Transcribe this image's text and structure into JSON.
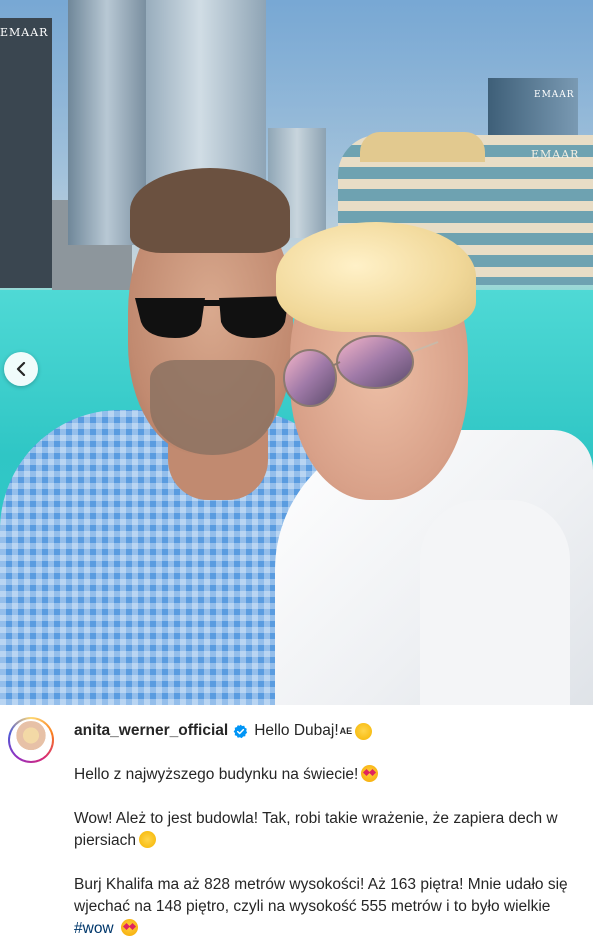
{
  "photo": {
    "signs": {
      "left": "EMAAR",
      "mall": "EMAAR",
      "tower": "EMAAR"
    },
    "carousel": {
      "prev_icon": "chevron-left-icon"
    }
  },
  "post": {
    "username": "anita_werner_official",
    "verified_icon": "verified-badge-icon",
    "headline": "Hello Dubaj!",
    "headline_flag": "AE",
    "paragraphs": [
      "Hello z najwyższego budynku na świecie!",
      "Wow! Ależ to jest budowla! Tak, robi takie wrażenie, że zapiera dech w piersiach",
      "Burj Khalifa ma aż 828 metrów wysokości! Aż 163 piętra! Mnie udało się wjechać na 148 piętro, czyli na wysokość 555 metrów i to było wielkie"
    ],
    "hashtag": "#wow"
  },
  "colors": {
    "link": "#00376b",
    "verified": "#0095f6",
    "text": "#262626"
  }
}
